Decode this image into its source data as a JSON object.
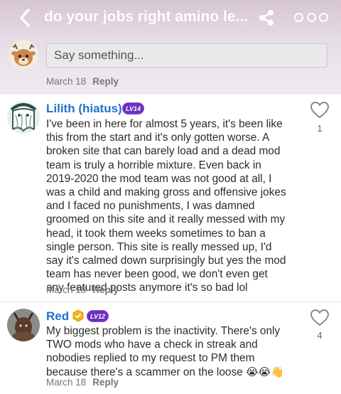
{
  "header": {
    "title": "do your jobs right amino le...",
    "back_icon": "chevron-left-icon",
    "share_icon": "share-icon",
    "more_icon": "more-icon"
  },
  "composer": {
    "placeholder": "Say something...",
    "date": "March 18",
    "reply_label": "Reply"
  },
  "comments": [
    {
      "username": "Lilith (hiatus)",
      "level": "LV14",
      "text": "I've been in here for almost 5 years, it's been like this from the start and it's only gotten worse. A broken site that can barely load and a dead mod team is truly a horrible mixture. Even back in 2019-2020 the mod team was not good at all, I was a child and making gross and offensive jokes and I faced no punishments, I was damned groomed on this site and it really messed with my head, it took them weeks sometimes to ban a single person. This site is really messed up, I'd say it's calmed down surprisingly but yes the mod team has never been good, we don't even get any featured posts anymore it's so bad lol",
      "date": "March 18",
      "reply_label": "Reply",
      "likes": "1"
    },
    {
      "username": "Red",
      "level": "LV12",
      "text": "My biggest problem is the inactivity. There's only TWO mods who have a check in streak and nobodies replied to my request to PM them because there's a scammer on the loose",
      "emojis": "😭😭👋",
      "date": "March 18",
      "reply_label": "Reply",
      "likes": "4"
    }
  ],
  "colors": {
    "accent_blue": "#1f74c9",
    "level_purple": "#6d2fc0",
    "badge_gold": "#f2b519"
  }
}
